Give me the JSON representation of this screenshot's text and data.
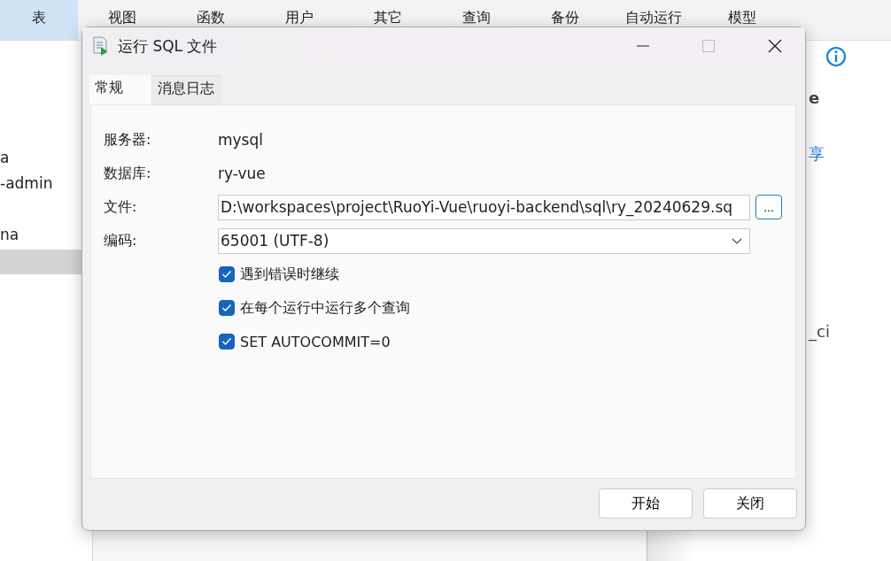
{
  "toolbar": {
    "items": [
      {
        "label": "表",
        "selected": true
      },
      {
        "label": "视图",
        "selected": false
      },
      {
        "label": "函数",
        "selected": false
      },
      {
        "label": "用户",
        "selected": false
      },
      {
        "label": "其它",
        "selected": false
      },
      {
        "label": "查询",
        "selected": false
      },
      {
        "label": "备份",
        "selected": false
      },
      {
        "label": "自动运行",
        "selected": false
      },
      {
        "label": "模型",
        "selected": false
      }
    ]
  },
  "sidebar": {
    "items": [
      {
        "label": "a",
        "selected": false
      },
      {
        "label": "-admin",
        "selected": false
      },
      {
        "label": "na",
        "selected": false
      },
      {
        "selected": true
      }
    ]
  },
  "right_panel": {
    "texts": [
      {
        "text": "e",
        "kind": "heading"
      },
      {
        "text": "享",
        "kind": "link"
      },
      {
        "text": "_ci",
        "kind": "plain"
      }
    ]
  },
  "dialog": {
    "title": "运行 SQL 文件",
    "tabs": [
      {
        "label": "常规",
        "selected": true
      },
      {
        "label": "消息日志",
        "selected": false
      }
    ],
    "info": [
      {
        "label": "服务器:",
        "value": "mysql"
      },
      {
        "label": "数据库:",
        "value": "ry-vue"
      }
    ],
    "file": {
      "label": "文件:",
      "value": "D:\\workspaces\\project\\RuoYi-Vue\\ruoyi-backend\\sql\\ry_20240629.sq",
      "browse": "..."
    },
    "encoding": {
      "label": "编码:",
      "value": "65001 (UTF-8)"
    },
    "options": [
      {
        "label": "遇到错误时继续",
        "checked": true
      },
      {
        "label": "在每个运行中运行多个查询",
        "checked": true
      },
      {
        "label": "SET AUTOCOMMIT=0",
        "checked": true
      }
    ],
    "buttons": [
      "开始",
      "关闭"
    ]
  }
}
